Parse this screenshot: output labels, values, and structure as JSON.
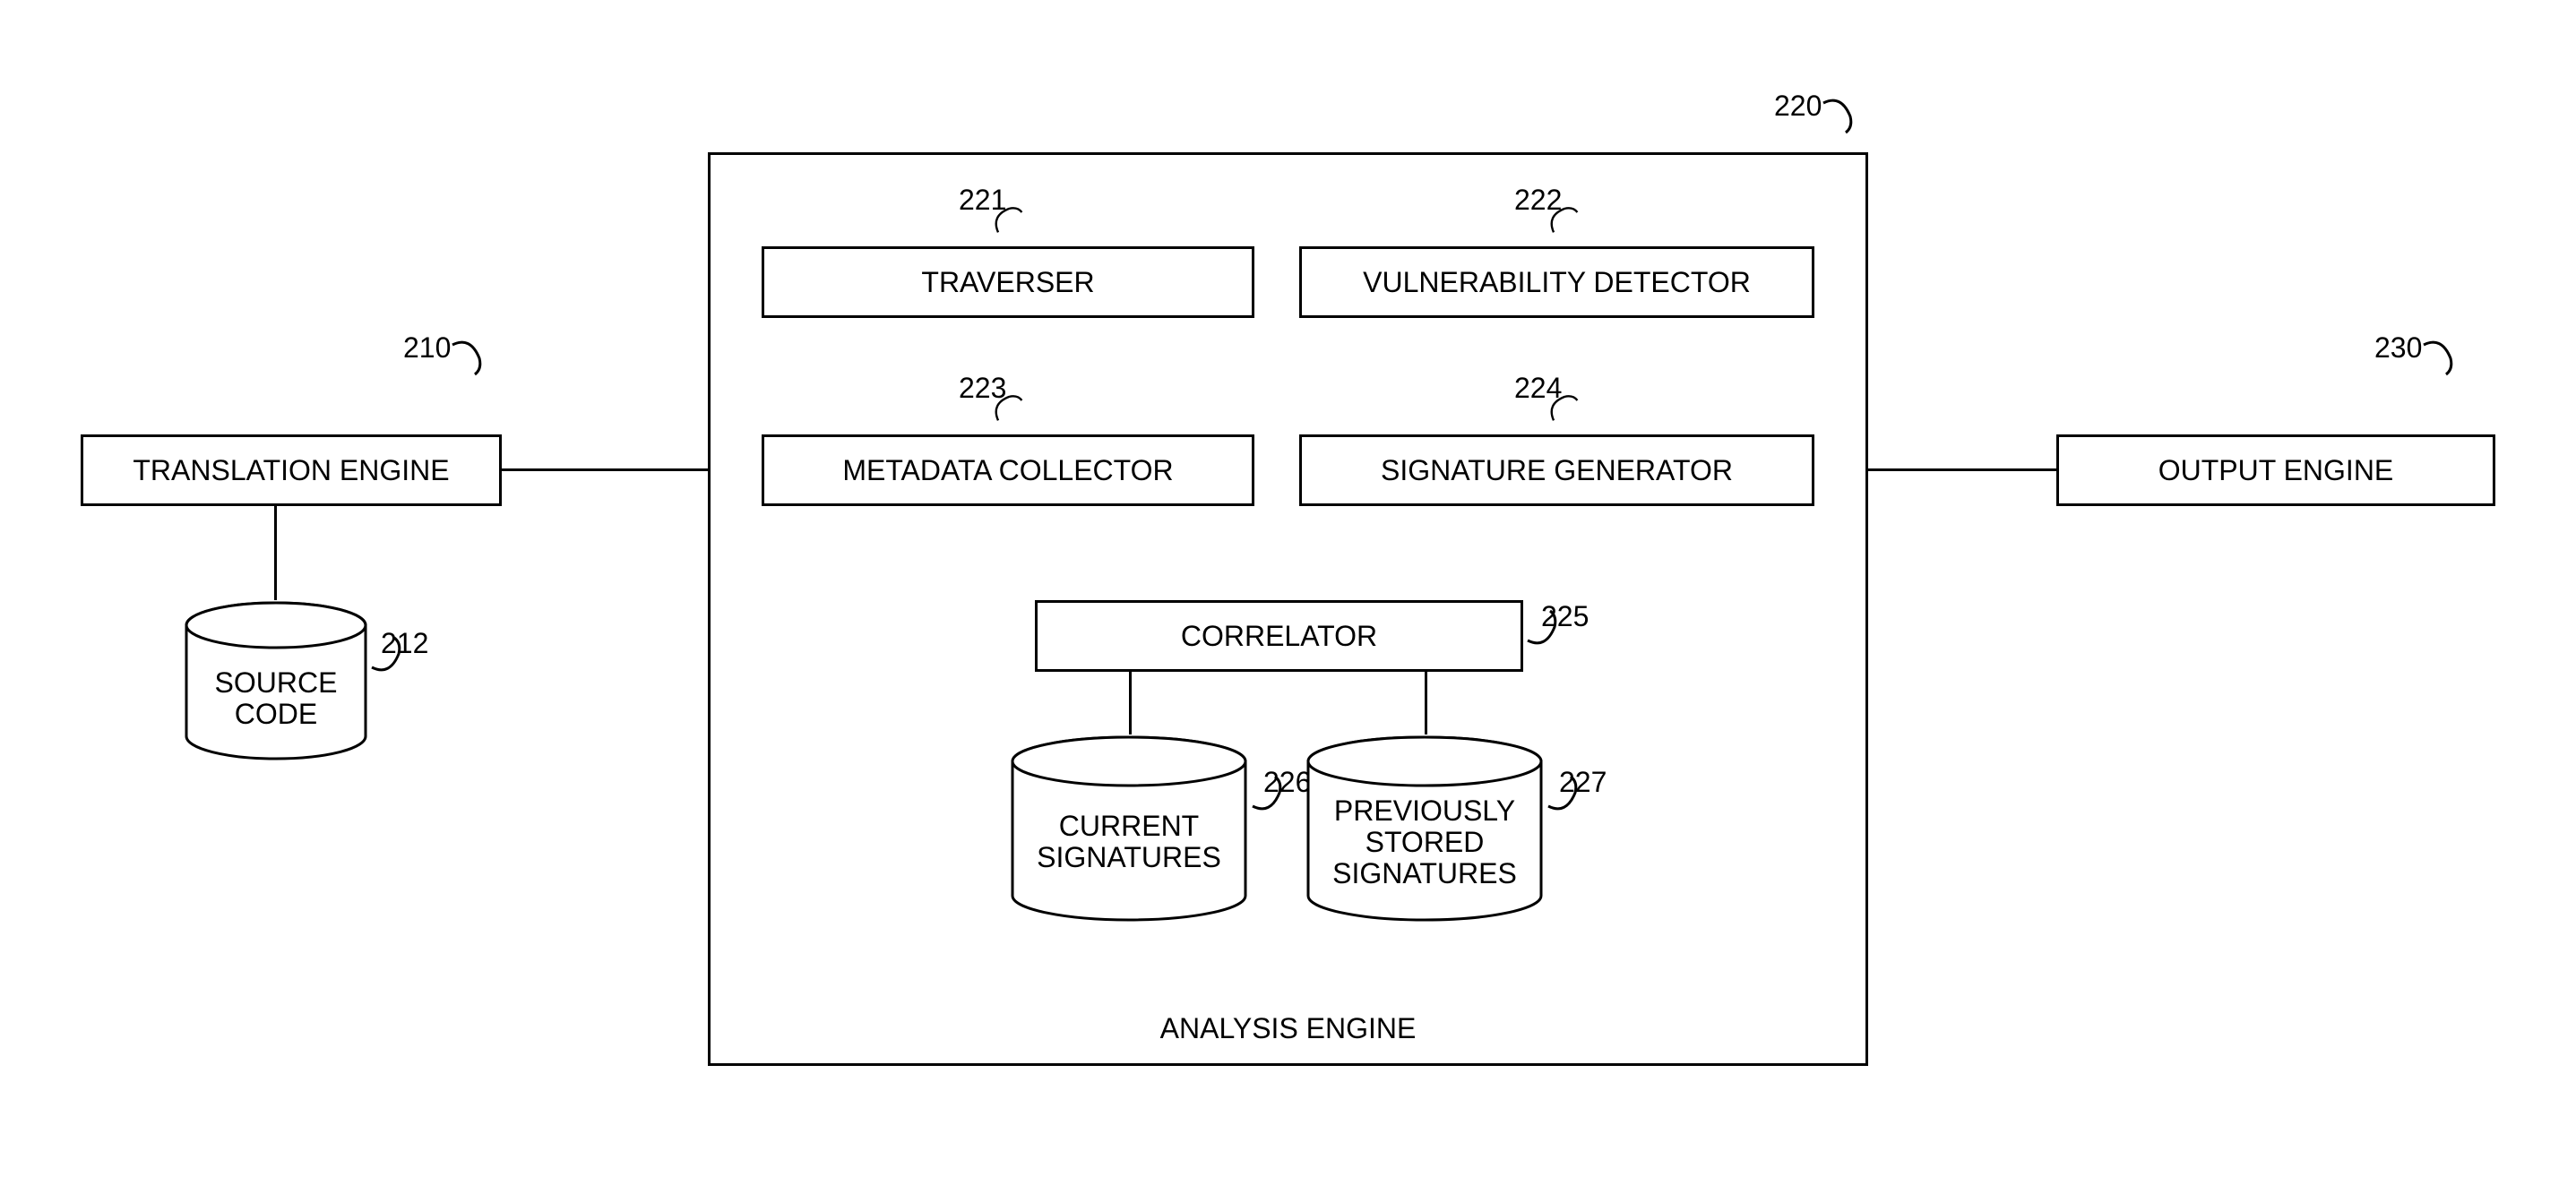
{
  "refs": {
    "translation_engine": "210",
    "source_code": "212",
    "analysis_engine": "220",
    "traverser": "221",
    "vuln_detector": "222",
    "metadata_collector": "223",
    "signature_generator": "224",
    "correlator": "225",
    "current_signatures": "226",
    "prev_signatures": "227",
    "output_engine": "230"
  },
  "labels": {
    "translation_engine": "TRANSLATION ENGINE",
    "source_code": "SOURCE\nCODE",
    "traverser": "TRAVERSER",
    "vuln_detector": "VULNERABILITY DETECTOR",
    "metadata_collector": "METADATA COLLECTOR",
    "signature_generator": "SIGNATURE GENERATOR",
    "correlator": "CORRELATOR",
    "current_signatures": "CURRENT\nSIGNATURES",
    "prev_signatures": "PREVIOUSLY\nSTORED\nSIGNATURES",
    "analysis_engine": "ANALYSIS ENGINE",
    "output_engine": "OUTPUT ENGINE"
  }
}
